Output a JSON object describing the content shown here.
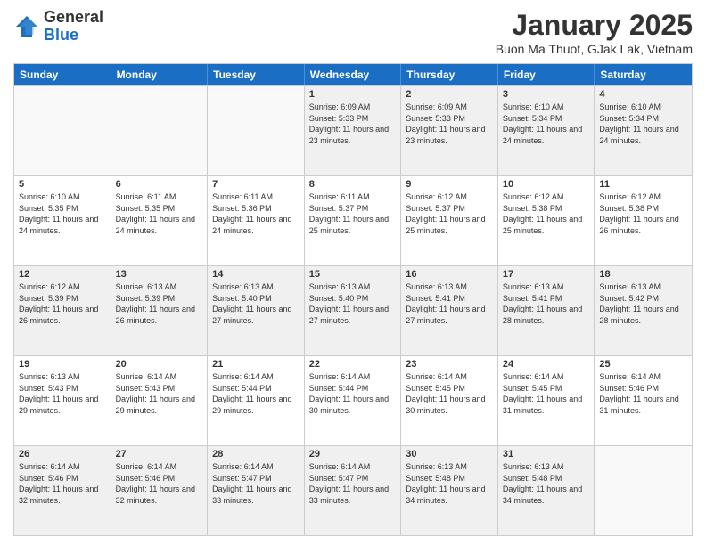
{
  "logo": {
    "general": "General",
    "blue": "Blue"
  },
  "title": "January 2025",
  "subtitle": "Buon Ma Thuot, GJak Lak, Vietnam",
  "headers": [
    "Sunday",
    "Monday",
    "Tuesday",
    "Wednesday",
    "Thursday",
    "Friday",
    "Saturday"
  ],
  "rows": [
    [
      {
        "day": "",
        "info": ""
      },
      {
        "day": "",
        "info": ""
      },
      {
        "day": "",
        "info": ""
      },
      {
        "day": "1",
        "info": "Sunrise: 6:09 AM\nSunset: 5:33 PM\nDaylight: 11 hours and 23 minutes."
      },
      {
        "day": "2",
        "info": "Sunrise: 6:09 AM\nSunset: 5:33 PM\nDaylight: 11 hours and 23 minutes."
      },
      {
        "day": "3",
        "info": "Sunrise: 6:10 AM\nSunset: 5:34 PM\nDaylight: 11 hours and 24 minutes."
      },
      {
        "day": "4",
        "info": "Sunrise: 6:10 AM\nSunset: 5:34 PM\nDaylight: 11 hours and 24 minutes."
      }
    ],
    [
      {
        "day": "5",
        "info": "Sunrise: 6:10 AM\nSunset: 5:35 PM\nDaylight: 11 hours and 24 minutes."
      },
      {
        "day": "6",
        "info": "Sunrise: 6:11 AM\nSunset: 5:35 PM\nDaylight: 11 hours and 24 minutes."
      },
      {
        "day": "7",
        "info": "Sunrise: 6:11 AM\nSunset: 5:36 PM\nDaylight: 11 hours and 24 minutes."
      },
      {
        "day": "8",
        "info": "Sunrise: 6:11 AM\nSunset: 5:37 PM\nDaylight: 11 hours and 25 minutes."
      },
      {
        "day": "9",
        "info": "Sunrise: 6:12 AM\nSunset: 5:37 PM\nDaylight: 11 hours and 25 minutes."
      },
      {
        "day": "10",
        "info": "Sunrise: 6:12 AM\nSunset: 5:38 PM\nDaylight: 11 hours and 25 minutes."
      },
      {
        "day": "11",
        "info": "Sunrise: 6:12 AM\nSunset: 5:38 PM\nDaylight: 11 hours and 26 minutes."
      }
    ],
    [
      {
        "day": "12",
        "info": "Sunrise: 6:12 AM\nSunset: 5:39 PM\nDaylight: 11 hours and 26 minutes."
      },
      {
        "day": "13",
        "info": "Sunrise: 6:13 AM\nSunset: 5:39 PM\nDaylight: 11 hours and 26 minutes."
      },
      {
        "day": "14",
        "info": "Sunrise: 6:13 AM\nSunset: 5:40 PM\nDaylight: 11 hours and 27 minutes."
      },
      {
        "day": "15",
        "info": "Sunrise: 6:13 AM\nSunset: 5:40 PM\nDaylight: 11 hours and 27 minutes."
      },
      {
        "day": "16",
        "info": "Sunrise: 6:13 AM\nSunset: 5:41 PM\nDaylight: 11 hours and 27 minutes."
      },
      {
        "day": "17",
        "info": "Sunrise: 6:13 AM\nSunset: 5:41 PM\nDaylight: 11 hours and 28 minutes."
      },
      {
        "day": "18",
        "info": "Sunrise: 6:13 AM\nSunset: 5:42 PM\nDaylight: 11 hours and 28 minutes."
      }
    ],
    [
      {
        "day": "19",
        "info": "Sunrise: 6:13 AM\nSunset: 5:43 PM\nDaylight: 11 hours and 29 minutes."
      },
      {
        "day": "20",
        "info": "Sunrise: 6:14 AM\nSunset: 5:43 PM\nDaylight: 11 hours and 29 minutes."
      },
      {
        "day": "21",
        "info": "Sunrise: 6:14 AM\nSunset: 5:44 PM\nDaylight: 11 hours and 29 minutes."
      },
      {
        "day": "22",
        "info": "Sunrise: 6:14 AM\nSunset: 5:44 PM\nDaylight: 11 hours and 30 minutes."
      },
      {
        "day": "23",
        "info": "Sunrise: 6:14 AM\nSunset: 5:45 PM\nDaylight: 11 hours and 30 minutes."
      },
      {
        "day": "24",
        "info": "Sunrise: 6:14 AM\nSunset: 5:45 PM\nDaylight: 11 hours and 31 minutes."
      },
      {
        "day": "25",
        "info": "Sunrise: 6:14 AM\nSunset: 5:46 PM\nDaylight: 11 hours and 31 minutes."
      }
    ],
    [
      {
        "day": "26",
        "info": "Sunrise: 6:14 AM\nSunset: 5:46 PM\nDaylight: 11 hours and 32 minutes."
      },
      {
        "day": "27",
        "info": "Sunrise: 6:14 AM\nSunset: 5:46 PM\nDaylight: 11 hours and 32 minutes."
      },
      {
        "day": "28",
        "info": "Sunrise: 6:14 AM\nSunset: 5:47 PM\nDaylight: 11 hours and 33 minutes."
      },
      {
        "day": "29",
        "info": "Sunrise: 6:14 AM\nSunset: 5:47 PM\nDaylight: 11 hours and 33 minutes."
      },
      {
        "day": "30",
        "info": "Sunrise: 6:13 AM\nSunset: 5:48 PM\nDaylight: 11 hours and 34 minutes."
      },
      {
        "day": "31",
        "info": "Sunrise: 6:13 AM\nSunset: 5:48 PM\nDaylight: 11 hours and 34 minutes."
      },
      {
        "day": "",
        "info": ""
      }
    ]
  ]
}
